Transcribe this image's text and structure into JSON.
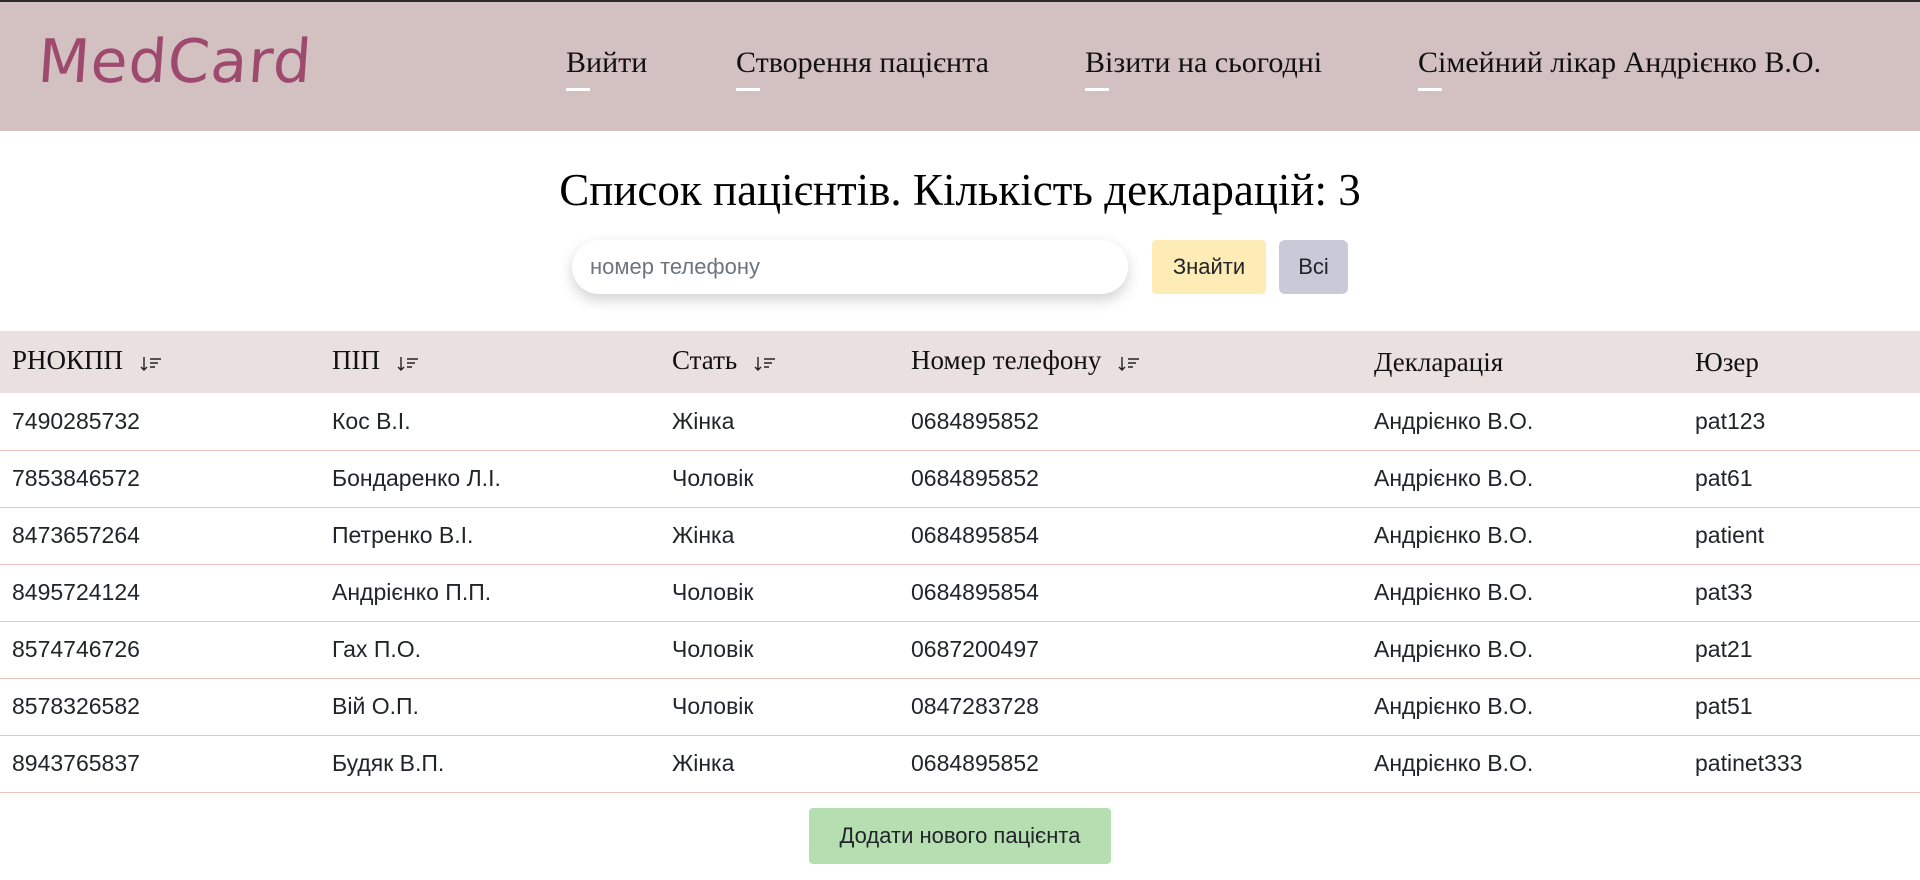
{
  "app": {
    "logo": "MedCard"
  },
  "nav": {
    "items": [
      {
        "label": "Вийти"
      },
      {
        "label": "Створення пацієнта"
      },
      {
        "label": "Візити на сьогодні"
      },
      {
        "label": "Сімейний лікар Андрієнко В.О."
      }
    ]
  },
  "page": {
    "title": "Список пацієнтів. Кількість декларацій: 3"
  },
  "search": {
    "placeholder": "номер телефону",
    "value": "",
    "find_label": "Знайти",
    "all_label": "Всі"
  },
  "table": {
    "columns": [
      {
        "label": "РНОКПП",
        "sortable": true
      },
      {
        "label": "ПІП",
        "sortable": true
      },
      {
        "label": "Стать",
        "sortable": true
      },
      {
        "label": "Номер телефону",
        "sortable": true
      },
      {
        "label": "Декларація",
        "sortable": false
      },
      {
        "label": "Юзер",
        "sortable": false
      }
    ],
    "rows": [
      [
        "7490285732",
        "Кос В.І.",
        "Жінка",
        "0684895852",
        "Андрієнко В.О.",
        "pat123"
      ],
      [
        "7853846572",
        "Бондаренко Л.І.",
        "Чоловік",
        "0684895852",
        "Андрієнко В.О.",
        "pat61"
      ],
      [
        "8473657264",
        "Петренко В.І.",
        "Жінка",
        "0684895854",
        "Андрієнко В.О.",
        "patient"
      ],
      [
        "8495724124",
        "Андрієнко П.П.",
        "Чоловік",
        "0684895854",
        "Андрієнко В.О.",
        "pat33"
      ],
      [
        "8574746726",
        "Гах П.О.",
        "Чоловік",
        "0687200497",
        "Андрієнко В.О.",
        "pat21"
      ],
      [
        "8578326582",
        "Вій О.П.",
        "Чоловік",
        "0847283728",
        "Андрієнко В.О.",
        "pat51"
      ],
      [
        "8943765837",
        "Будяк В.П.",
        "Жінка",
        "0684895852",
        "Андрієнко В.О.",
        "patinet333"
      ]
    ]
  },
  "actions": {
    "add_patient_label": "Додати нового пацієнта"
  },
  "colors": {
    "header_bg": "#d3c0c0",
    "logo": "#9e4a6e",
    "table_header_bg": "#ebe0e0",
    "row_divider": "#efc6bc",
    "find_button": "#fdecb5",
    "all_button": "#c9cad8",
    "add_button": "#b5dfb0"
  },
  "icons": {
    "sort": "sort-descending-icon"
  }
}
